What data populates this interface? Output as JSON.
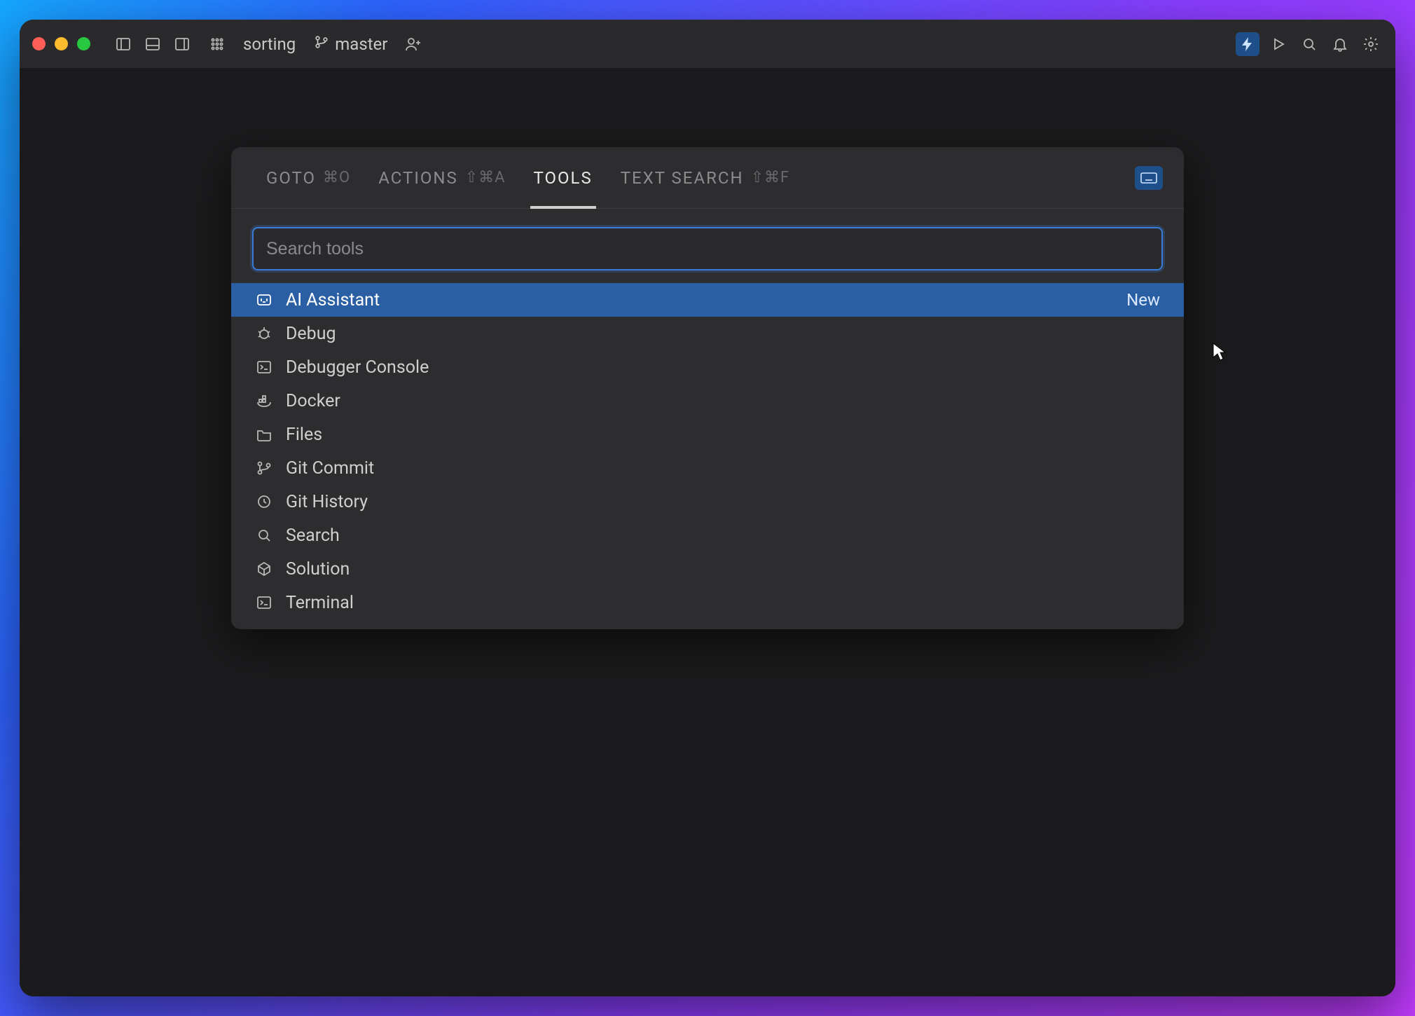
{
  "titlebar": {
    "project_name": "sorting",
    "branch_name": "master"
  },
  "popup": {
    "tabs": [
      {
        "label": "GOTO",
        "shortcut": "⌘O",
        "active": false
      },
      {
        "label": "ACTIONS",
        "shortcut": "⇧⌘A",
        "active": false
      },
      {
        "label": "TOOLS",
        "shortcut": "",
        "active": true
      },
      {
        "label": "TEXT SEARCH",
        "shortcut": "⇧⌘F",
        "active": false
      }
    ],
    "search_placeholder": "Search tools",
    "search_value": "",
    "results": [
      {
        "icon": "ai-icon",
        "label": "AI Assistant",
        "badge": "New",
        "selected": true
      },
      {
        "icon": "bug-icon",
        "label": "Debug",
        "badge": "",
        "selected": false
      },
      {
        "icon": "console-icon",
        "label": "Debugger Console",
        "badge": "",
        "selected": false
      },
      {
        "icon": "docker-icon",
        "label": "Docker",
        "badge": "",
        "selected": false
      },
      {
        "icon": "folder-icon",
        "label": "Files",
        "badge": "",
        "selected": false
      },
      {
        "icon": "branch-icon",
        "label": "Git Commit",
        "badge": "",
        "selected": false
      },
      {
        "icon": "clock-icon",
        "label": "Git History",
        "badge": "",
        "selected": false
      },
      {
        "icon": "search-icon",
        "label": "Search",
        "badge": "",
        "selected": false
      },
      {
        "icon": "solution-icon",
        "label": "Solution",
        "badge": "",
        "selected": false
      },
      {
        "icon": "terminal-icon",
        "label": "Terminal",
        "badge": "",
        "selected": false
      }
    ]
  }
}
